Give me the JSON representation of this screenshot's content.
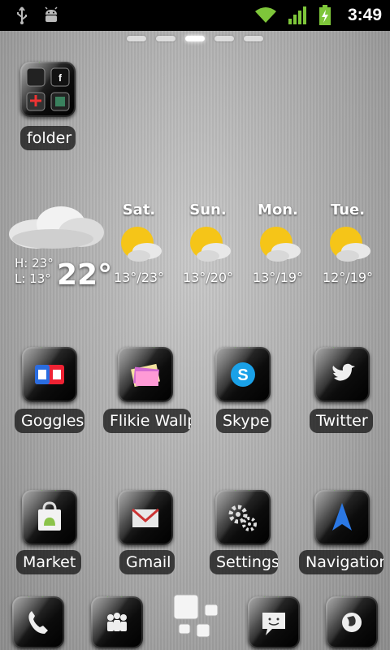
{
  "status_bar": {
    "time": "3:49",
    "icons": [
      "usb-icon",
      "android-debug-icon",
      "wifi-icon",
      "signal-icon",
      "battery-charging-icon"
    ]
  },
  "pager": {
    "count": 5,
    "active_index": 2
  },
  "folder": {
    "label": "folder"
  },
  "weather": {
    "current": {
      "high": "H: 23°",
      "low": "L: 13°",
      "temp": "22°"
    },
    "forecast": [
      {
        "day": "Sat.",
        "range": "13°/23°"
      },
      {
        "day": "Sun.",
        "range": "13°/20°"
      },
      {
        "day": "Mon.",
        "range": "13°/19°"
      },
      {
        "day": "Tue.",
        "range": "12°/19°"
      }
    ]
  },
  "apps_row1": [
    {
      "label": "Goggles",
      "icon": "goggles-icon"
    },
    {
      "label": "Flikie Wallp",
      "icon": "flikie-icon"
    },
    {
      "label": "Skype",
      "icon": "skype-icon"
    },
    {
      "label": "Twitter",
      "icon": "twitter-bird-icon"
    }
  ],
  "apps_row2": [
    {
      "label": "Market",
      "icon": "market-bag-icon"
    },
    {
      "label": "Gmail",
      "icon": "gmail-envelope-icon"
    },
    {
      "label": "Settings",
      "icon": "gears-icon"
    },
    {
      "label": "Navigation",
      "icon": "navigation-arrow-icon"
    }
  ],
  "dock": [
    {
      "icon": "phone-icon"
    },
    {
      "icon": "contacts-icon"
    },
    {
      "icon": "app-drawer-icon"
    },
    {
      "icon": "messaging-icon"
    },
    {
      "icon": "browser-globe-icon"
    }
  ],
  "colors": {
    "accent_green": "#5bd12e",
    "label_bg": "#141414",
    "sun": "#f5c518"
  }
}
